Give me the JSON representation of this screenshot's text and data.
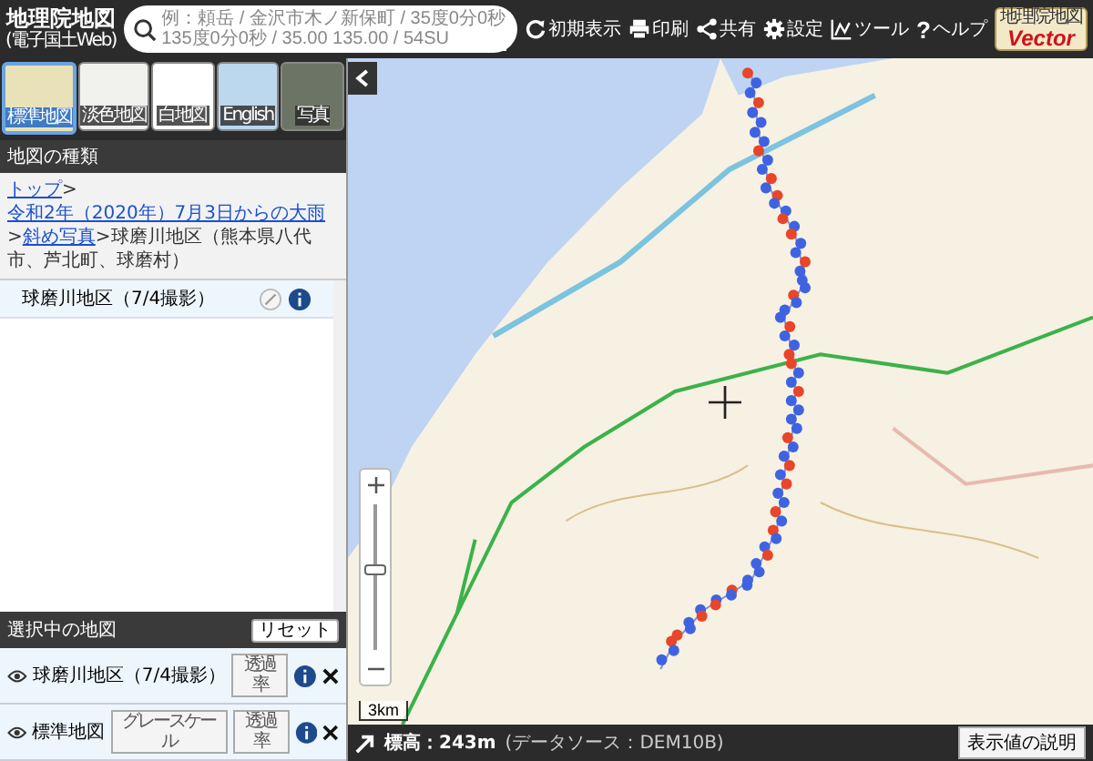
{
  "header": {
    "title": "地理院地図",
    "subtitle": "(電子国土Web)",
    "search": {
      "placeholder": "例：頼岳 / 金沢市木ノ新保町 / 35度0分0秒 135度0分0秒 / 35.00 135.00 / 54SU"
    },
    "toolbar": [
      {
        "kind": "refresh",
        "label": "初期表示"
      },
      {
        "kind": "print",
        "label": "印刷"
      },
      {
        "kind": "share",
        "label": "共有"
      },
      {
        "kind": "settings",
        "label": "設定"
      },
      {
        "kind": "tools",
        "label": "ツール"
      },
      {
        "kind": "help",
        "glyph": "?",
        "label": "ヘルプ"
      }
    ],
    "logo": {
      "title": "地理院地図",
      "subtitle": "Vector"
    }
  },
  "map_types": [
    {
      "label": "標準地図",
      "kind": "standard",
      "selected": true
    },
    {
      "label": "淡色地図",
      "kind": "pale",
      "selected": false
    },
    {
      "label": "白地図",
      "kind": "blank",
      "selected": false
    },
    {
      "label": "English",
      "kind": "english",
      "selected": false
    },
    {
      "label": "写真",
      "kind": "photo",
      "selected": false
    }
  ],
  "map_list": {
    "title": "地図の種類",
    "breadcrumb": [
      {
        "kind": "link",
        "label": "トップ"
      },
      {
        "kind": "separator",
        "label": ">"
      },
      {
        "kind": "link",
        "label": "令和2年（2020年）7月3日からの大雨"
      },
      {
        "kind": "separator",
        "label": ">"
      },
      {
        "kind": "link",
        "label": "斜め写真"
      },
      {
        "kind": "separator",
        "label": ">"
      },
      {
        "kind": "text",
        "label": "球磨川地区（熊本県八代市、芦北町、球磨村）"
      }
    ],
    "items": [
      {
        "label": "球磨川地区（7/4撮影）"
      }
    ]
  },
  "selected_maps": {
    "title": "選択中の地図",
    "reset": "リセット",
    "items": [
      {
        "label": "球磨川地区（7/4撮影）",
        "visible": true,
        "buttons": [
          "透過率"
        ]
      },
      {
        "label": "標準地図",
        "visible": true,
        "buttons": [
          "グレースケール",
          "透過率"
        ]
      }
    ]
  },
  "map": {
    "scale": "3km",
    "zoom": {
      "level": 0.55
    }
  },
  "status_bar": {
    "elevation": "標高：243m",
    "source": "(データソース：DEM10B)",
    "button": "表示値の説明"
  }
}
